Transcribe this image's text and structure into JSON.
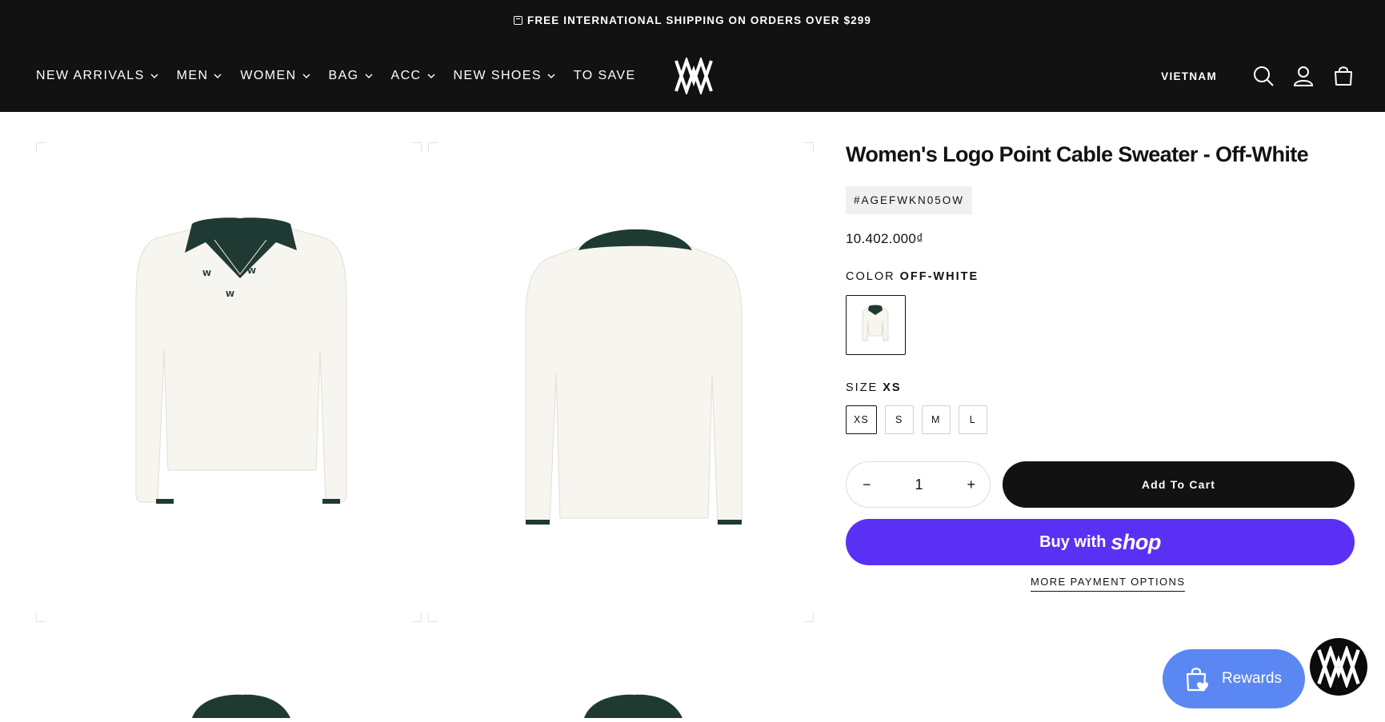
{
  "announcement": {
    "text": "FREE INTERNATIONAL SHIPPING ON ORDERS OVER $299",
    "icon": "calendar-icon"
  },
  "nav": {
    "items": [
      {
        "label": "NEW ARRIVALS",
        "has_dropdown": true
      },
      {
        "label": "MEN",
        "has_dropdown": true
      },
      {
        "label": "WOMEN",
        "has_dropdown": true
      },
      {
        "label": "BAG",
        "has_dropdown": true
      },
      {
        "label": "ACC",
        "has_dropdown": true
      },
      {
        "label": "NEW SHOES",
        "has_dropdown": true
      },
      {
        "label": "TO SAVE",
        "has_dropdown": false
      }
    ]
  },
  "header": {
    "country": "VIETNAM",
    "icons": [
      "search-icon",
      "account-icon",
      "cart-icon"
    ]
  },
  "product": {
    "title": "Women's Logo Point Cable Sweater - Off-White",
    "sku": "#AGEFWKN05OW",
    "price": "10.402.000₫",
    "color_label": "COLOR",
    "color_value": "OFF-WHITE",
    "size_label": "SIZE",
    "size_value": "XS",
    "sizes": [
      "XS",
      "S",
      "M",
      "L"
    ],
    "quantity": "1",
    "add_to_cart": "Add To Cart",
    "buy_with": "Buy with",
    "shop_word": "shop",
    "more_payment": "MORE PAYMENT OPTIONS"
  },
  "widgets": {
    "rewards_label": "Rewards"
  },
  "colors": {
    "header_bg": "#121212",
    "shop_pay": "#5a31f4",
    "rewards": "#5b87f2",
    "collar_green": "#1f3a32",
    "sweater": "#f7f5ef"
  }
}
